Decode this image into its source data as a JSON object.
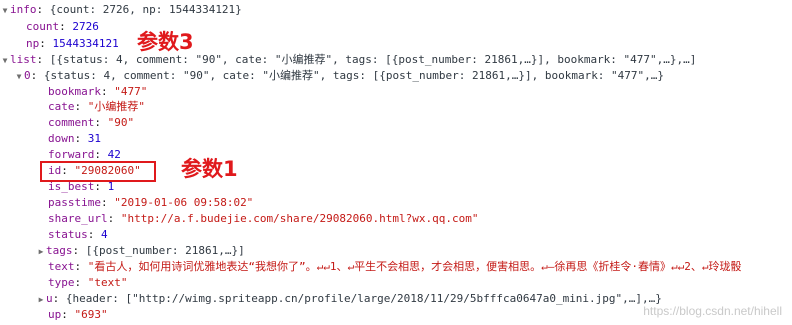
{
  "lines": [
    {
      "toggle": "▼",
      "key": "info",
      "sep": ": ",
      "val": "{count: 2726, np: 1544334121}",
      "cls": "plain"
    },
    {
      "toggle": "",
      "key": "count",
      "sep": ": ",
      "val": "2726",
      "cls": "num"
    },
    {
      "toggle": "",
      "key": "np",
      "sep": ": ",
      "val": "1544334121",
      "cls": "num"
    },
    {
      "toggle": "▼",
      "key": "list",
      "sep": ": ",
      "val": "[{status: 4, comment: \"90\", cate: \"小编推荐\", tags: [{post_number: 21861,…}], bookmark: \"477\",…},…]",
      "cls": "plain"
    },
    {
      "toggle": "▼",
      "key": "0",
      "sep": ": ",
      "val": "{status: 4, comment: \"90\", cate: \"小编推荐\", tags: [{post_number: 21861,…}], bookmark: \"477\",…}",
      "cls": "plain"
    },
    {
      "toggle": "",
      "key": "bookmark",
      "sep": ": ",
      "val": "\"477\"",
      "cls": "str"
    },
    {
      "toggle": "",
      "key": "cate",
      "sep": ": ",
      "val": "\"小编推荐\"",
      "cls": "str"
    },
    {
      "toggle": "",
      "key": "comment",
      "sep": ": ",
      "val": "\"90\"",
      "cls": "str"
    },
    {
      "toggle": "",
      "key": "down",
      "sep": ": ",
      "val": "31",
      "cls": "num"
    },
    {
      "toggle": "",
      "key": "forward",
      "sep": ": ",
      "val": "42",
      "cls": "num"
    },
    {
      "toggle": "",
      "key": "id",
      "sep": ": ",
      "val": "\"29082060\"",
      "cls": "str"
    },
    {
      "toggle": "",
      "key": "is_best",
      "sep": ": ",
      "val": "1",
      "cls": "num"
    },
    {
      "toggle": "",
      "key": "passtime",
      "sep": ": ",
      "val": "\"2019-01-06 09:58:02\"",
      "cls": "str"
    },
    {
      "toggle": "",
      "key": "share_url",
      "sep": ": ",
      "val": "\"http://a.f.budejie.com/share/29082060.html?wx.qq.com\"",
      "cls": "str"
    },
    {
      "toggle": "",
      "key": "status",
      "sep": ": ",
      "val": "4",
      "cls": "num"
    },
    {
      "toggle": "▶",
      "key": "tags",
      "sep": ": ",
      "val": "[{post_number: 21861,…}]",
      "cls": "plain"
    },
    {
      "toggle": "",
      "key": "text",
      "sep": ": ",
      "val": "\"看古人，如何用诗词优雅地表达“我想你了”。↵↵1、↵平生不会相思，才会相思，便害相思。↵—徐再思《折桂令·春情》↵↵2、↵玲珑骰",
      "cls": "str"
    },
    {
      "toggle": "",
      "key": "type",
      "sep": ": ",
      "val": "\"text\"",
      "cls": "str"
    },
    {
      "toggle": "▶",
      "key": "u",
      "sep": ": ",
      "val": "{header: [\"http://wimg.spriteapp.cn/profile/large/2018/11/29/5bfffca0647a0_mini.jpg\",…],…}",
      "cls": "plain"
    },
    {
      "toggle": "",
      "key": "up",
      "sep": ": ",
      "val": "\"693\"",
      "cls": "str"
    }
  ],
  "annotations": {
    "param3": "参数3",
    "param1": "参数1"
  },
  "watermark": "https://blog.csdn.net/hihell",
  "colors": {
    "key": "#881391",
    "string": "#c41a16",
    "number": "#1c00cf",
    "annotation": "#e0191c"
  }
}
